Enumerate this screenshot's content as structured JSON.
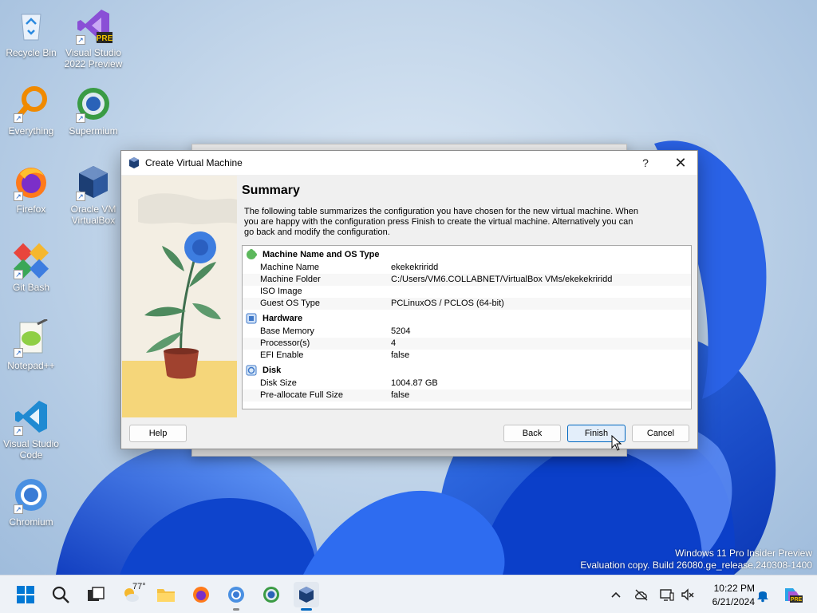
{
  "desktop": {
    "icons": [
      {
        "label": "Recycle Bin"
      },
      {
        "label": "Visual Studio 2022 Preview",
        "badge": "PRE"
      },
      {
        "label": "Everything"
      },
      {
        "label": "Supermium"
      },
      {
        "label": "Firefox"
      },
      {
        "label": "Oracle VM VirtualBox"
      },
      {
        "label": "Git Bash"
      },
      {
        "label": "Notepad++"
      },
      {
        "label": "Visual Studio Code"
      },
      {
        "label": "Chromium"
      }
    ],
    "watermark_line1": "Windows 11 Pro Insider Preview",
    "watermark_line2": "Evaluation copy. Build 26080.ge_release.240308-1400"
  },
  "dialog": {
    "title": "Create Virtual Machine",
    "help_glyph": "?",
    "close_glyph": "✕",
    "heading": "Summary",
    "description": "The following table summarizes the configuration you have chosen for the new virtual machine. When you are happy with the configuration press Finish to create the virtual machine. Alternatively you can go back and modify the configuration.",
    "sections": [
      {
        "title": "Machine Name and OS Type",
        "icon": "puzzle-icon",
        "rows": [
          {
            "key": "Machine Name",
            "value": "ekekekriridd"
          },
          {
            "key": "Machine Folder",
            "value": "C:/Users/VM6.COLLABNET/VirtualBox VMs/ekekekriridd"
          },
          {
            "key": "ISO Image",
            "value": ""
          },
          {
            "key": "Guest OS Type",
            "value": "PCLinuxOS / PCLOS (64-bit)"
          }
        ]
      },
      {
        "title": "Hardware",
        "icon": "chip-icon",
        "rows": [
          {
            "key": "Base Memory",
            "value": "5204"
          },
          {
            "key": "Processor(s)",
            "value": "4"
          },
          {
            "key": "EFI Enable",
            "value": "false"
          }
        ]
      },
      {
        "title": "Disk",
        "icon": "disk-icon",
        "rows": [
          {
            "key": "Disk Size",
            "value": "1004.87 GB"
          },
          {
            "key": "Pre-allocate Full Size",
            "value": "false"
          }
        ]
      }
    ],
    "buttons": {
      "help": "Help",
      "back": "Back",
      "finish": "Finish",
      "cancel": "Cancel"
    }
  },
  "taskbar": {
    "weather_temp": "77°",
    "clock_time": "10:22 PM",
    "clock_date": "6/21/2024",
    "tray_badge": "PRE"
  },
  "colors": {
    "accent": "#0067c0",
    "wallpaper_blue": "#1a56d8"
  }
}
